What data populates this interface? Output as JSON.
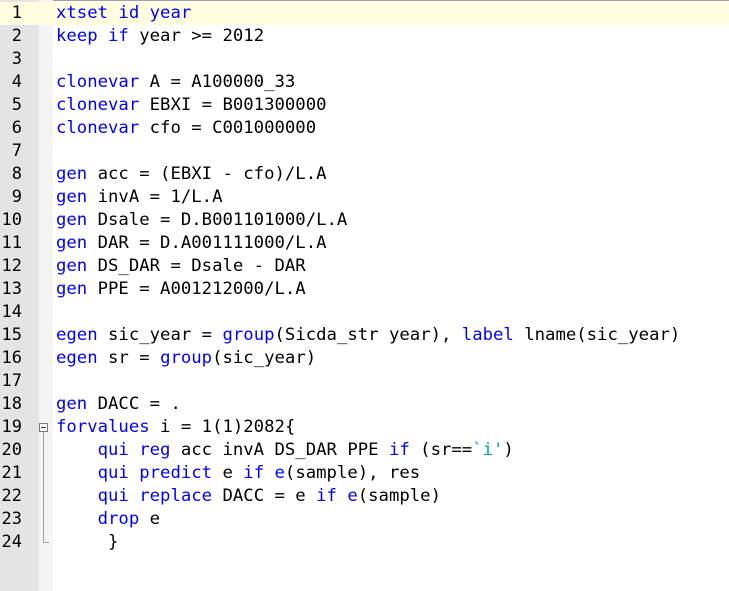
{
  "editor": {
    "lines": [
      {
        "n": "1",
        "segs": [
          {
            "t": "xtset id year",
            "k": "kw"
          }
        ],
        "current": true
      },
      {
        "n": "2",
        "segs": [
          {
            "t": "keep if",
            "k": "kw"
          },
          {
            "t": " year >= 2012",
            "k": ""
          }
        ]
      },
      {
        "n": "3",
        "segs": []
      },
      {
        "n": "4",
        "segs": [
          {
            "t": "clonevar",
            "k": "kw"
          },
          {
            "t": " A = A100000_33",
            "k": ""
          }
        ]
      },
      {
        "n": "5",
        "segs": [
          {
            "t": "clonevar",
            "k": "kw"
          },
          {
            "t": " EBXI = B001300000",
            "k": ""
          }
        ]
      },
      {
        "n": "6",
        "segs": [
          {
            "t": "clonevar",
            "k": "kw"
          },
          {
            "t": " cfo = C001000000",
            "k": ""
          }
        ]
      },
      {
        "n": "7",
        "segs": []
      },
      {
        "n": "8",
        "segs": [
          {
            "t": "gen",
            "k": "kw"
          },
          {
            "t": " acc = (EBXI - cfo)/L.A",
            "k": ""
          }
        ]
      },
      {
        "n": "9",
        "segs": [
          {
            "t": "gen",
            "k": "kw"
          },
          {
            "t": " invA = 1/L.A",
            "k": ""
          }
        ]
      },
      {
        "n": "10",
        "segs": [
          {
            "t": "gen",
            "k": "kw"
          },
          {
            "t": " Dsale = D.B001101000/L.A",
            "k": ""
          }
        ]
      },
      {
        "n": "11",
        "segs": [
          {
            "t": "gen",
            "k": "kw"
          },
          {
            "t": " DAR = D.A001111000/L.A",
            "k": ""
          }
        ]
      },
      {
        "n": "12",
        "segs": [
          {
            "t": "gen",
            "k": "kw"
          },
          {
            "t": " DS_DAR = Dsale - DAR",
            "k": ""
          }
        ]
      },
      {
        "n": "13",
        "segs": [
          {
            "t": "gen",
            "k": "kw"
          },
          {
            "t": " PPE = A001212000/L.A",
            "k": ""
          }
        ]
      },
      {
        "n": "14",
        "segs": []
      },
      {
        "n": "15",
        "segs": [
          {
            "t": "egen",
            "k": "kw"
          },
          {
            "t": " sic_year = ",
            "k": ""
          },
          {
            "t": "group",
            "k": "kw"
          },
          {
            "t": "(Sicda_str year), ",
            "k": ""
          },
          {
            "t": "label",
            "k": "kw"
          },
          {
            "t": " lname(sic_year)",
            "k": ""
          }
        ]
      },
      {
        "n": "16",
        "segs": [
          {
            "t": "egen",
            "k": "kw"
          },
          {
            "t": " sr = ",
            "k": ""
          },
          {
            "t": "group",
            "k": "kw"
          },
          {
            "t": "(sic_year)",
            "k": ""
          }
        ]
      },
      {
        "n": "17",
        "segs": []
      },
      {
        "n": "18",
        "segs": [
          {
            "t": "gen",
            "k": "kw"
          },
          {
            "t": " DACC = .",
            "k": ""
          }
        ]
      },
      {
        "n": "19",
        "segs": [
          {
            "t": "forvalues",
            "k": "kw"
          },
          {
            "t": " i = 1(1)2082{",
            "k": ""
          }
        ],
        "fold": true
      },
      {
        "n": "20",
        "segs": [
          {
            "t": "    qui reg",
            "k": "kw"
          },
          {
            "t": " acc invA DS_DAR PPE ",
            "k": ""
          },
          {
            "t": "if",
            "k": "kw"
          },
          {
            "t": " (sr==",
            "k": ""
          },
          {
            "t": "`i'",
            "k": "tick"
          },
          {
            "t": ")",
            "k": ""
          }
        ]
      },
      {
        "n": "21",
        "segs": [
          {
            "t": "    qui predict",
            "k": "kw"
          },
          {
            "t": " e ",
            "k": ""
          },
          {
            "t": "if",
            "k": "kw"
          },
          {
            "t": " ",
            "k": ""
          },
          {
            "t": "e",
            "k": "kw"
          },
          {
            "t": "(sample), res",
            "k": ""
          }
        ]
      },
      {
        "n": "22",
        "segs": [
          {
            "t": "    qui replace",
            "k": "kw"
          },
          {
            "t": " DACC = e ",
            "k": ""
          },
          {
            "t": "if",
            "k": "kw"
          },
          {
            "t": " ",
            "k": ""
          },
          {
            "t": "e",
            "k": "kw"
          },
          {
            "t": "(sample)",
            "k": ""
          }
        ]
      },
      {
        "n": "23",
        "segs": [
          {
            "t": "    drop",
            "k": "kw"
          },
          {
            "t": " e",
            "k": ""
          }
        ]
      },
      {
        "n": "24",
        "segs": [
          {
            "t": "     }",
            "k": ""
          }
        ],
        "foldEnd": true
      }
    ]
  }
}
